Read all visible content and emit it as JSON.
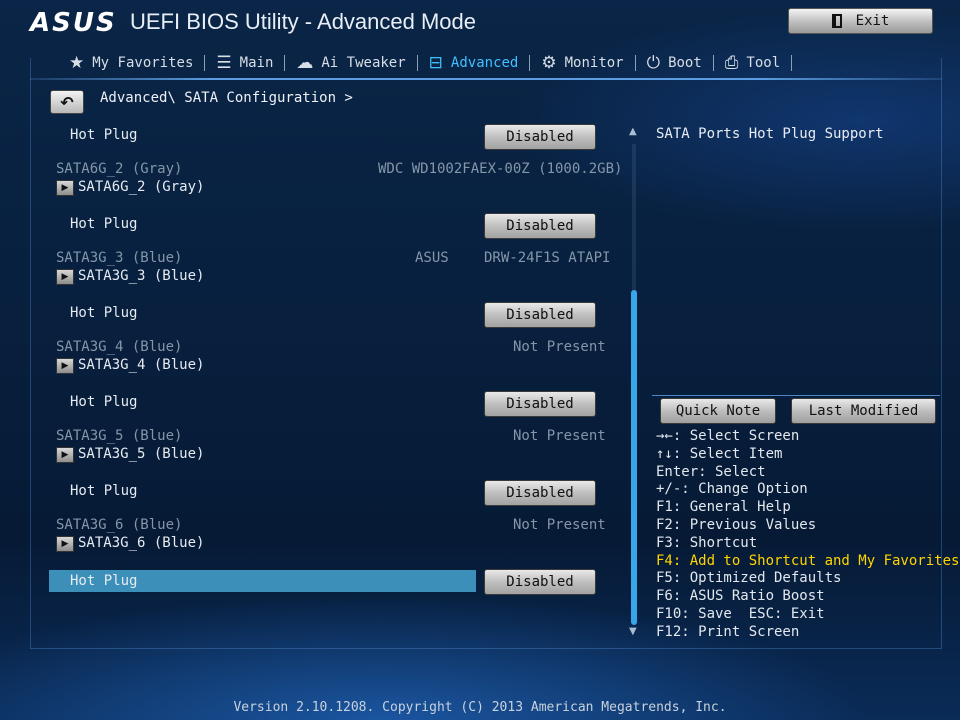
{
  "header": {
    "logo": "ASUS",
    "title": "UEFI BIOS Utility - Advanced Mode",
    "exit_label": "Exit"
  },
  "tabs": [
    {
      "label": "My Favorites",
      "icon": "★"
    },
    {
      "label": "Main",
      "icon": "☰"
    },
    {
      "label": "Ai Tweaker",
      "icon": "☁"
    },
    {
      "label": "Advanced",
      "icon": "⊟"
    },
    {
      "label": "Monitor",
      "icon": "⚙"
    },
    {
      "label": "Boot",
      "icon": "⏻"
    },
    {
      "label": "Tool",
      "icon": "⎙"
    }
  ],
  "breadcrumb": "Advanced\\ SATA Configuration >",
  "settings": {
    "hotplug_label": "Hot Plug",
    "hotplug_value": "Disabled",
    "ports": [
      {
        "name": "SATA6G_2 (Gray)",
        "info_left": "",
        "info": "WDC WD1002FAEX-00Z (1000.2GB)"
      },
      {
        "name": "SATA3G_3 (Blue)",
        "info_left": "ASUS",
        "info": "DRW-24F1S ATAPI"
      },
      {
        "name": "SATA3G_4 (Blue)",
        "info_left": "",
        "info": "Not Present"
      },
      {
        "name": "SATA3G_5 (Blue)",
        "info_left": "",
        "info": "Not Present"
      },
      {
        "name": "SATA3G_6 (Blue)",
        "info_left": "",
        "info": "Not Present"
      }
    ]
  },
  "help": {
    "title": "SATA Ports Hot Plug Support"
  },
  "right_buttons": {
    "quick_note": "Quick Note",
    "last_modified": "Last Modified"
  },
  "keys": [
    "→←: Select Screen",
    "↑↓: Select Item",
    "Enter: Select",
    "+/-: Change Option",
    "F1: General Help",
    "F2: Previous Values",
    "F3: Shortcut",
    "F4: Add to Shortcut and My Favorites",
    "F5: Optimized Defaults",
    "F6: ASUS Ratio Boost",
    "F10: Save  ESC: Exit",
    "F12: Print Screen"
  ],
  "highlight_color": "#ffd400",
  "accent_color": "#3fc1ff",
  "footer": "Version 2.10.1208. Copyright (C) 2013 American Megatrends, Inc."
}
